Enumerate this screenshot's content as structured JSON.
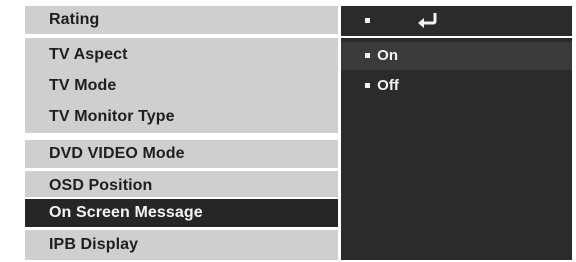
{
  "menu": {
    "items": [
      {
        "label": "Rating"
      },
      {
        "label": "TV Aspect"
      },
      {
        "label": "TV Mode"
      },
      {
        "label": "TV Monitor Type"
      },
      {
        "label": "DVD VIDEO Mode"
      },
      {
        "label": "OSD  Position"
      },
      {
        "label": "On Screen Message"
      },
      {
        "label": "IPB Display"
      }
    ],
    "selected": "On Screen Message"
  },
  "options": {
    "items": [
      {
        "label": "On"
      },
      {
        "label": "Off"
      }
    ],
    "highlighted": "On"
  },
  "icons": {
    "return": "return-arrow-icon",
    "bullet": "bullet-icon"
  },
  "colors": {
    "menu_background": "#cfcfcf",
    "selected_background": "#262626",
    "panel_background": "#2b2b2b",
    "text_dark": "#1e1e1e",
    "text_light": "#f4f4f4"
  }
}
